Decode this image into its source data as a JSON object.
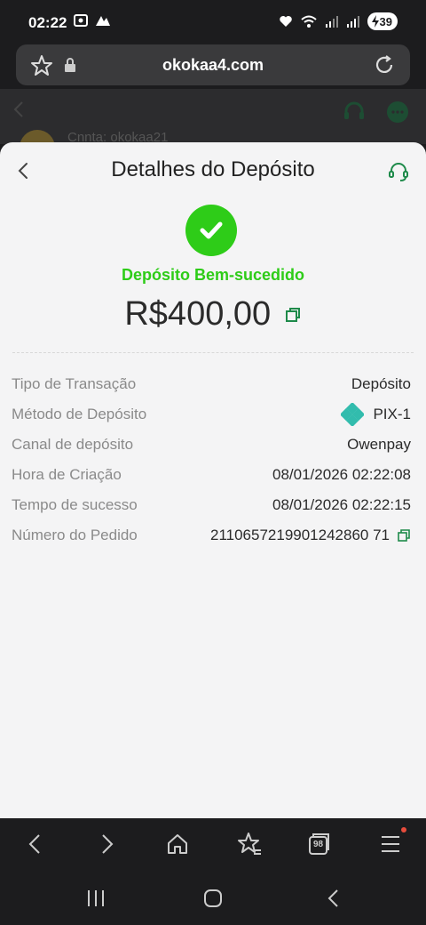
{
  "status_bar": {
    "time": "02:22",
    "battery": "39"
  },
  "browser": {
    "url": "okokaa4.com"
  },
  "background_page": {
    "text": "Cnnta: okokaa21"
  },
  "sheet": {
    "title": "Detalhes do Depósito",
    "status": "Depósito Bem-sucedido",
    "amount": "R$400,00",
    "rows": [
      {
        "label": "Tipo de Transação",
        "value": "Depósito"
      },
      {
        "label": "Método de Depósito",
        "value": "PIX-1"
      },
      {
        "label": "Canal de depósito",
        "value": "Owenpay"
      },
      {
        "label": "Hora de Criação",
        "value": "08/01/2026 02:22:08"
      },
      {
        "label": "Tempo de sucesso",
        "value": "08/01/2026 02:22:15"
      },
      {
        "label": "Número do Pedido",
        "value": "2110657219901242860 71"
      }
    ]
  },
  "tab_count": "98",
  "colors": {
    "success": "#2ecc18",
    "pix": "#32bcad",
    "accent": "#1e8a4a"
  }
}
